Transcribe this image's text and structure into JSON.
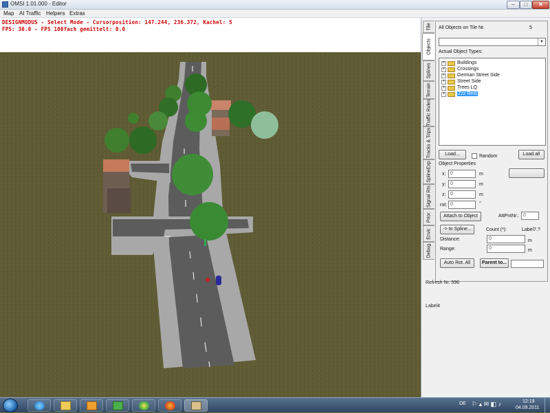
{
  "window": {
    "title": "OMSI 1.01.000 - Editor",
    "close_glyph": "✕",
    "max_glyph": "□",
    "min_glyph": "–"
  },
  "menu": [
    "Map",
    "AI Traffic",
    "Helpers",
    "Extras"
  ],
  "hud": {
    "line1": "DESIGNMODUS - Select Mode - Cursorposition: 147.244, 236.372, Kachel: 5",
    "line2": "FPS: 30.0 - FPS 100fach gemittelt: 0.0",
    "color": "#cc0000"
  },
  "scene": {
    "grass_color": "#5f5b34",
    "sky_color": "#ffffff",
    "road_color": "#5a5a5a",
    "sidewalk_color": "#a9a9a9"
  },
  "tabs": [
    "Tile",
    "Objects",
    "Splines",
    "Terrain",
    "Traffic Rules",
    "Tracks & Trips",
    "SplineExp",
    "Signal Rts",
    "Prior.",
    "Envir.",
    "Debug"
  ],
  "panel": {
    "header_label": "All Objects on Tile Nr.",
    "header_value": "5",
    "actual_types_label": "Actual Object Types:",
    "tree": [
      {
        "label": "Buildings",
        "expander": "+"
      },
      {
        "label": "Crossings",
        "expander": "+"
      },
      {
        "label": "German Street Side",
        "expander": "+"
      },
      {
        "label": "Street Side",
        "expander": "+"
      },
      {
        "label": "Trees LQ",
        "expander": "+"
      },
      {
        "label": "Zzz Rest",
        "expander": "+",
        "selected": true
      }
    ],
    "load_button": "Load...",
    "random_label": "Random",
    "load_all_button": "Load all",
    "object_properties_label": "Object Properties",
    "x_label": "x:",
    "y_label": "y:",
    "z_label": "z:",
    "rot_label": "rot:",
    "x_value": "0",
    "y_value": "0",
    "z_value": "0",
    "rot_value": "0",
    "unit_m": "m",
    "unit_deg": "°",
    "attach_button": "Attach to Object",
    "att_pnt_label": "AttPntNr.:",
    "att_pnt_value": "0",
    "to_spline_button": "-> to Spline...",
    "count_label": "Count (*):",
    "label7": "Label7.?",
    "distance_label": "Distance:",
    "distance_value": "0",
    "range_label": "Range:",
    "range_value": "0",
    "auto_rot_button": "Auto Rot. All",
    "parent_button": "Parent to...",
    "refresh_label": "Refresh Nr. 596",
    "label4": "Label4"
  },
  "taskbar": {
    "lang": "DE",
    "time": "12:19",
    "date": "04.09.2011",
    "pinned": [
      "explorer-icon",
      "ie-icon",
      "folder-icon",
      "media-player-icon",
      "network-icon",
      "icq-icon",
      "firefox-icon",
      "omsi-icon"
    ]
  }
}
